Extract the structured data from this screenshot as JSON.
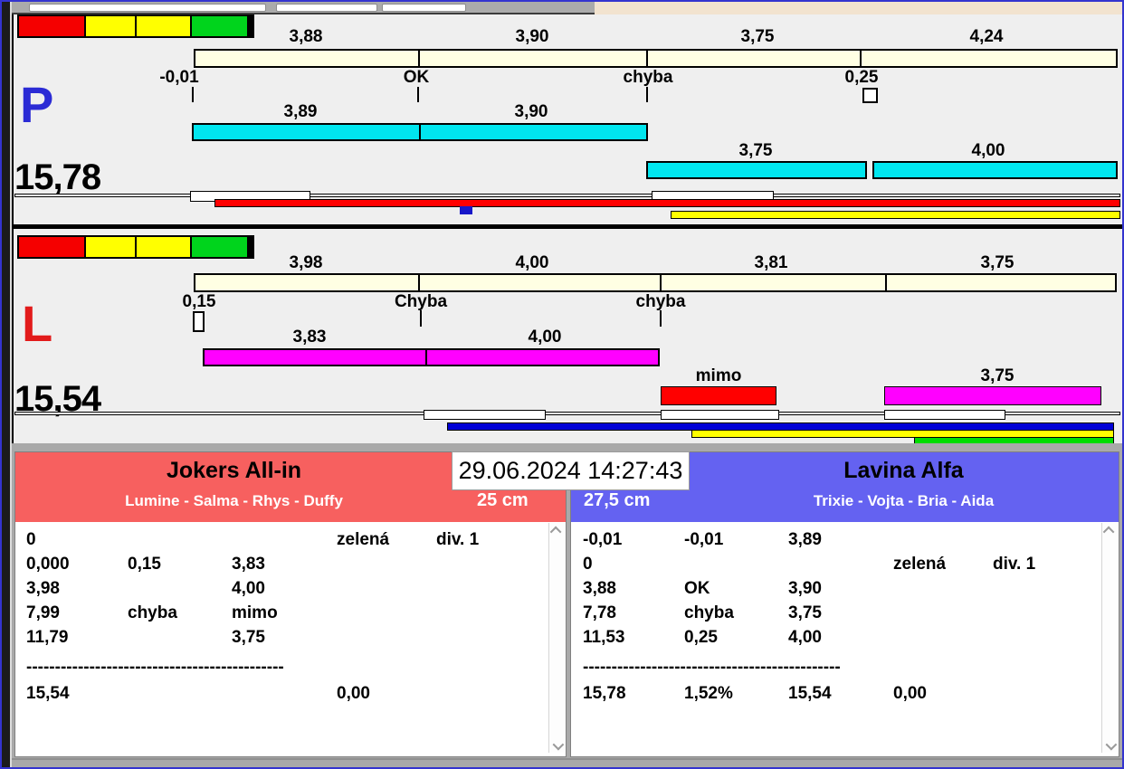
{
  "header": {
    "timestamp": "29.06.2024 14:27:43"
  },
  "lane_p": {
    "letter": "P",
    "total": "15,78",
    "splits": [
      "3,88",
      "3,90",
      "3,75",
      "4,24"
    ],
    "markers": [
      "-0,01",
      "OK",
      "chyba",
      "0,25"
    ],
    "heat_bars": [
      "3,89",
      "3,90"
    ],
    "heat_bars_2": [
      "3,75",
      "4,00"
    ]
  },
  "lane_l": {
    "letter": "L",
    "total": "15,54",
    "splits": [
      "3,98",
      "4,00",
      "3,81",
      "3,75"
    ],
    "markers": [
      "0,15",
      "Chyba",
      "chyba"
    ],
    "heat_bars": [
      "3,83",
      "4,00"
    ],
    "heat_bars_2": [
      "mimo",
      "3,75"
    ]
  },
  "team_left": {
    "name": "Jokers All-in",
    "dogs": "Lumine - Salma - Rhys - Duffy",
    "jump_height": "25 cm",
    "result_rows": [
      [
        "0",
        "",
        "",
        "zelená",
        "div. 1"
      ],
      [
        "0,000",
        "0,15",
        "3,83",
        "",
        ""
      ],
      [
        "3,98",
        "",
        "4,00",
        "",
        ""
      ],
      [
        "7,99",
        "chyba",
        "mimo",
        "",
        ""
      ],
      [
        "11,79",
        "",
        "3,75",
        "",
        ""
      ]
    ],
    "separator": "---------------------------------------------",
    "total_rows": [
      [
        "15,54",
        "",
        "",
        "0,00",
        ""
      ]
    ]
  },
  "team_right": {
    "name": "Lavina Alfa",
    "dogs": "Trixie - Vojta - Bria - Aida",
    "jump_height": "27,5 cm",
    "result_rows": [
      [
        "-0,01",
        "-0,01",
        "3,89",
        "",
        ""
      ],
      [
        "0",
        "",
        "",
        "zelená",
        "div. 1"
      ],
      [
        "3,88",
        "OK",
        "3,90",
        "",
        ""
      ],
      [
        "7,78",
        "chyba",
        "3,75",
        "",
        ""
      ],
      [
        "11,53",
        "0,25",
        "4,00",
        "",
        ""
      ]
    ],
    "separator": "---------------------------------------------",
    "total_rows": [
      [
        "15,78",
        "1,52%",
        "15,54",
        "0,00",
        ""
      ]
    ]
  },
  "colors": {
    "lane_p_letter": "#2B2BD5",
    "lane_l_letter": "#E21B1B",
    "team_left_header": "#F7605F",
    "team_right_header": "#6462F1",
    "split_bar": "#FFFFE3",
    "heat_bar_p": "#00E6EF",
    "heat_bar_l": "#FF00FF",
    "status_red": "#FF0000",
    "status_yellow": "#FFFF00",
    "status_green": "#00D41C",
    "status_blue": "#0000D6"
  }
}
